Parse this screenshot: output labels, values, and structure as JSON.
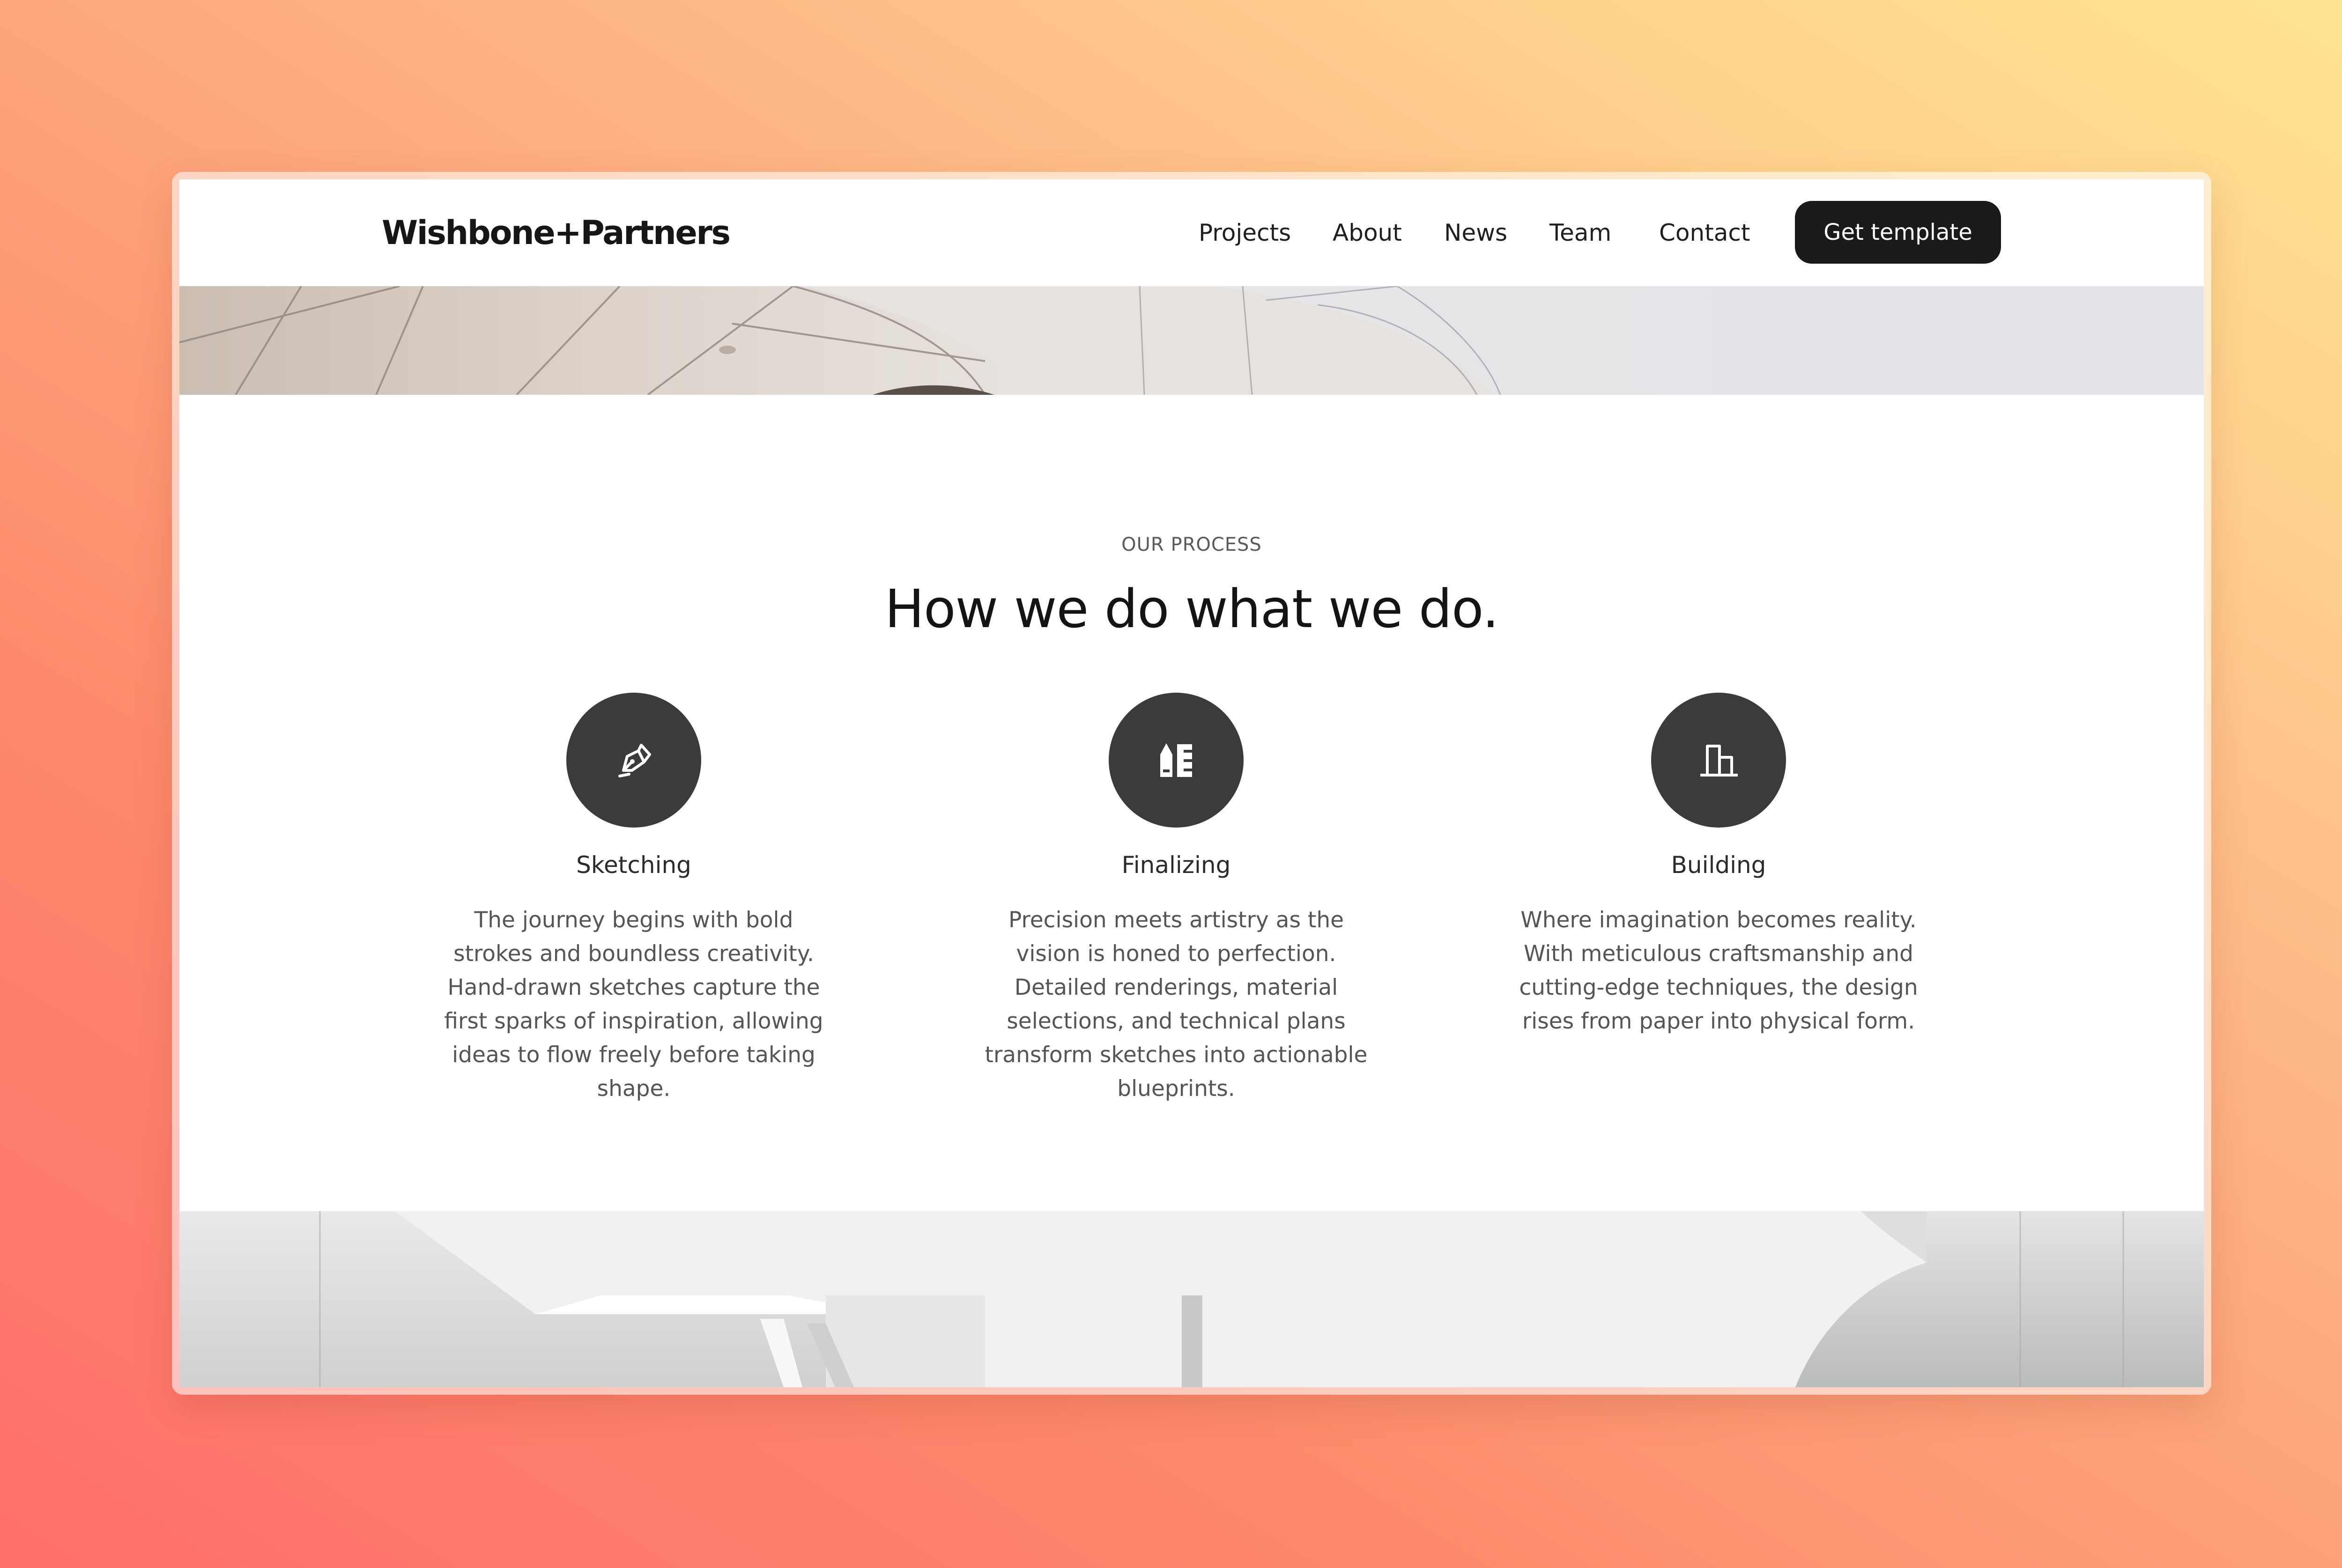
{
  "navbar": {
    "logo": "Wishbone+Partners",
    "links": [
      "Projects",
      "About",
      "News",
      "Team",
      "Contact"
    ],
    "cta_label": "Get template"
  },
  "process": {
    "eyebrow": "OUR PROCESS",
    "title": "How we do what we do.",
    "steps": [
      {
        "icon": "pen-nib-icon",
        "title": "Sketching",
        "description": "The journey begins with bold strokes and boundless creativity. Hand-drawn sketches capture the first sparks of inspiration, allowing ideas to flow freely before taking shape."
      },
      {
        "icon": "blueprint-pencil-ruler-icon",
        "title": "Finalizing",
        "description": "Precision meets artistry as the vision is honed to perfection. Detailed renderings, material selections, and technical plans transform sketches into actionable blueprints."
      },
      {
        "icon": "building-icon",
        "title": "Building",
        "description": "Where imagination becomes reality. With meticulous craftsmanship and cutting-edge techniques, the design rises from paper into physical form."
      }
    ]
  },
  "colors": {
    "background_gradient_start": "#ff6f6b",
    "background_gradient_end": "#ffe492",
    "icon_circle": "#3b3b3b",
    "cta_background": "#1a1a1a",
    "text_dark": "#141414",
    "text_muted": "#555555"
  }
}
